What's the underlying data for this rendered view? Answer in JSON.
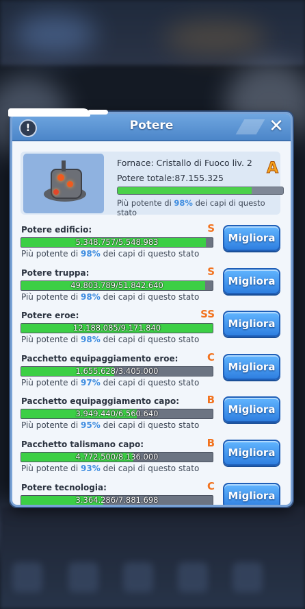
{
  "dialog": {
    "title": "Potere",
    "info_label": "!",
    "close_label": "✕"
  },
  "summary": {
    "building_name": "Fornace: Cristallo di Fuoco liv. 2",
    "total_label": "Potere totale:87.155.325",
    "grade": "A",
    "progress": 0.81,
    "pct_prefix": "Più potente di ",
    "pct_value": "98%",
    "pct_suffix": " dei capi di questo stato"
  },
  "rows": [
    {
      "label": "Potere edificio:",
      "grade": "S",
      "value_text": "5.348.757/5.548.983",
      "fill": 0.964,
      "pct": "98%",
      "button": "Migliora"
    },
    {
      "label": "Potere truppa:",
      "grade": "S",
      "value_text": "49.803.789/51.842.640",
      "fill": 0.961,
      "pct": "98%",
      "button": "Migliora"
    },
    {
      "label": "Potere eroe:",
      "grade": "SS",
      "value_text": "12.188.085/9.171.840",
      "fill": 1.0,
      "pct": "98%",
      "button": "Migliora"
    },
    {
      "label": "Pacchetto equipaggiamento eroe:",
      "grade": "C",
      "value_text": "1.655.628/3.405.000",
      "fill": 0.486,
      "pct": "97%",
      "button": "Migliora"
    },
    {
      "label": "Pacchetto equipaggiamento capo:",
      "grade": "B",
      "value_text": "3.949.440/6.560.640",
      "fill": 0.602,
      "pct": "95%",
      "button": "Migliora"
    },
    {
      "label": "Pacchetto talismano capo:",
      "grade": "B",
      "value_text": "4.772.500/8.136.000",
      "fill": 0.587,
      "pct": "93%",
      "button": "Migliora"
    },
    {
      "label": "Potere tecnologia:",
      "grade": "C",
      "value_text": "3.364.286/7.881.698",
      "fill": 0.427,
      "pct": "",
      "button": "Migliora"
    }
  ],
  "row_sub_prefix": "Più potente di ",
  "row_sub_suffix": " dei capi di questo stato",
  "colors": {
    "accent": "#3f8de0",
    "bar_fill": "#3ccf45",
    "grade": "#f2731f"
  }
}
